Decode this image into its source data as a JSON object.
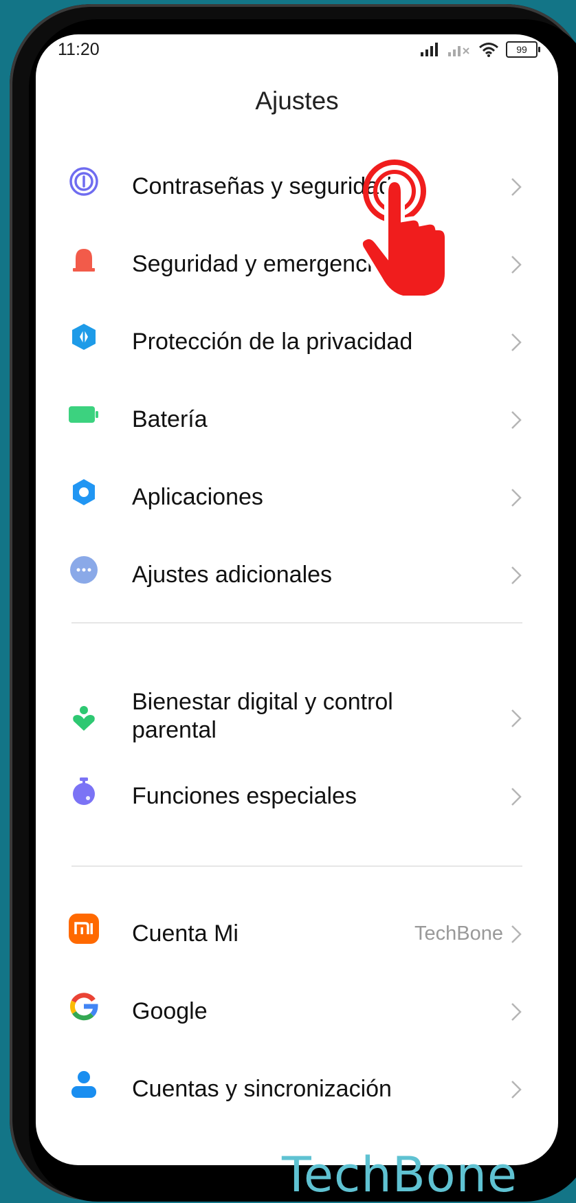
{
  "status_bar": {
    "time": "11:20",
    "battery": "99"
  },
  "header": {
    "title": "Ajustes"
  },
  "settings": [
    {
      "label": "Contraseñas y seguridad",
      "icon": "fingerprint-icon"
    },
    {
      "label": "Seguridad y emergencia",
      "icon": "siren-icon"
    },
    {
      "label": "Protección de la privacidad",
      "icon": "privacy-shield-icon"
    },
    {
      "label": "Batería",
      "icon": "battery-icon"
    },
    {
      "label": "Aplicaciones",
      "icon": "gear-icon"
    },
    {
      "label": "Ajustes adicionales",
      "icon": "more-dots-icon"
    },
    {
      "label_line1": "Bienestar digital y control",
      "label_line2": "parental",
      "icon": "wellbeing-heart-icon"
    },
    {
      "label": "Funciones especiales",
      "icon": "special-features-icon"
    },
    {
      "label": "Cuenta Mi",
      "value": "TechBone",
      "icon": "mi-logo-icon"
    },
    {
      "label": "Google",
      "icon": "google-logo-icon"
    },
    {
      "label": "Cuentas y sincronización",
      "icon": "account-person-icon"
    }
  ],
  "watermark": "TechBone",
  "colors": {
    "background": "#137587",
    "fingerprint": "#6f6cf0",
    "siren": "#f25b4a",
    "privacy": "#1e9be8",
    "battery": "#3cd27f",
    "gear": "#2196f3",
    "more": "#8aa9e8",
    "wellbeing": "#2ec872",
    "special": "#7b73f5",
    "mi": "#ff6900",
    "account": "#1a8ef0",
    "tap_hand": "#f01d1d"
  }
}
